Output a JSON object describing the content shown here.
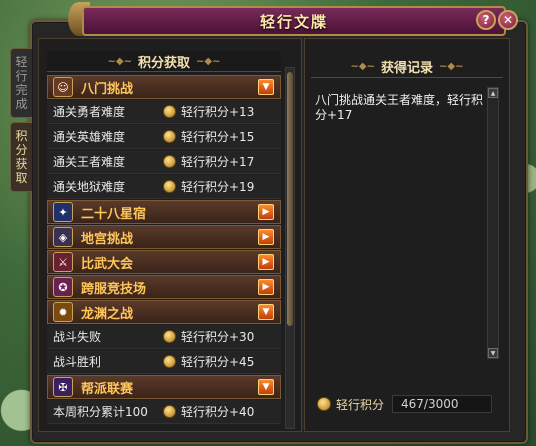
{
  "window": {
    "title": "轻行文牒",
    "help_label": "?",
    "close_label": "✕"
  },
  "side_tabs": [
    {
      "label": [
        "轻",
        "行",
        "完",
        "成"
      ]
    },
    {
      "label": [
        "积",
        "分",
        "获",
        "取"
      ]
    }
  ],
  "points_panel": {
    "header": "积分获取",
    "categories": [
      {
        "label": "八门挑战",
        "icon": "mask-icon",
        "expanded": true,
        "rows": [
          {
            "label": "通关勇者难度",
            "points": "轻行积分+13"
          },
          {
            "label": "通关英雄难度",
            "points": "轻行积分+15"
          },
          {
            "label": "通关王者难度",
            "points": "轻行积分+17"
          },
          {
            "label": "通关地狱难度",
            "points": "轻行积分+19"
          }
        ]
      },
      {
        "label": "二十八星宿",
        "icon": "star-icon",
        "expanded": false
      },
      {
        "label": "地宫挑战",
        "icon": "dungeon-icon",
        "expanded": false
      },
      {
        "label": "比武大会",
        "icon": "sword-icon",
        "expanded": false
      },
      {
        "label": "跨服竞技场",
        "icon": "arena-icon",
        "expanded": false
      },
      {
        "label": "龙渊之战",
        "icon": "dragon-icon",
        "expanded": true,
        "rows": [
          {
            "label": "战斗失败",
            "points": "轻行积分+30"
          },
          {
            "label": "战斗胜利",
            "points": "轻行积分+45"
          }
        ]
      },
      {
        "label": "帮派联赛",
        "icon": "guild-icon",
        "expanded": true,
        "rows": [
          {
            "label": "本周积分累计100",
            "points": "轻行积分+40"
          }
        ]
      }
    ]
  },
  "records": {
    "header": "获得记录",
    "text": "八门挑战通关王者难度，轻行积分+17"
  },
  "total": {
    "label": "轻行积分",
    "value": "467/3000"
  },
  "colors": {
    "accent": "#ffc65a",
    "title_bg": "#7a2a5a",
    "toggle": "#ff8a2a"
  }
}
